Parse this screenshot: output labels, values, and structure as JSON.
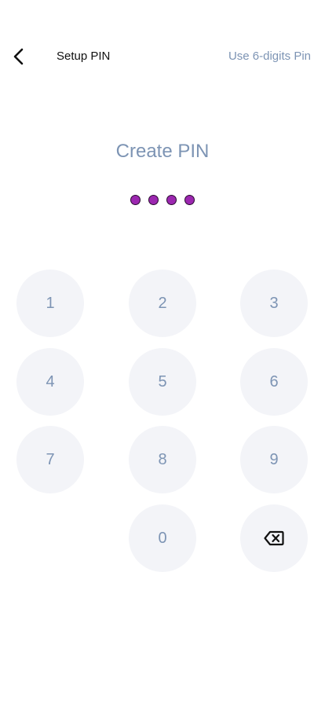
{
  "header": {
    "title": "Setup PIN",
    "alt_pin_link": "Use 6-digits Pin",
    "back_icon": "chevron-left-icon"
  },
  "main": {
    "title": "Create PIN",
    "pin_entered_count": 4,
    "pin_length": 4
  },
  "keypad": {
    "keys": [
      "1",
      "2",
      "3",
      "4",
      "5",
      "6",
      "7",
      "8",
      "9",
      "0"
    ],
    "backspace_icon": "backspace-icon"
  },
  "colors": {
    "accent_text": "#7d94b4",
    "dot_fill": "#9c27b0",
    "key_background": "#f3f4f8"
  }
}
